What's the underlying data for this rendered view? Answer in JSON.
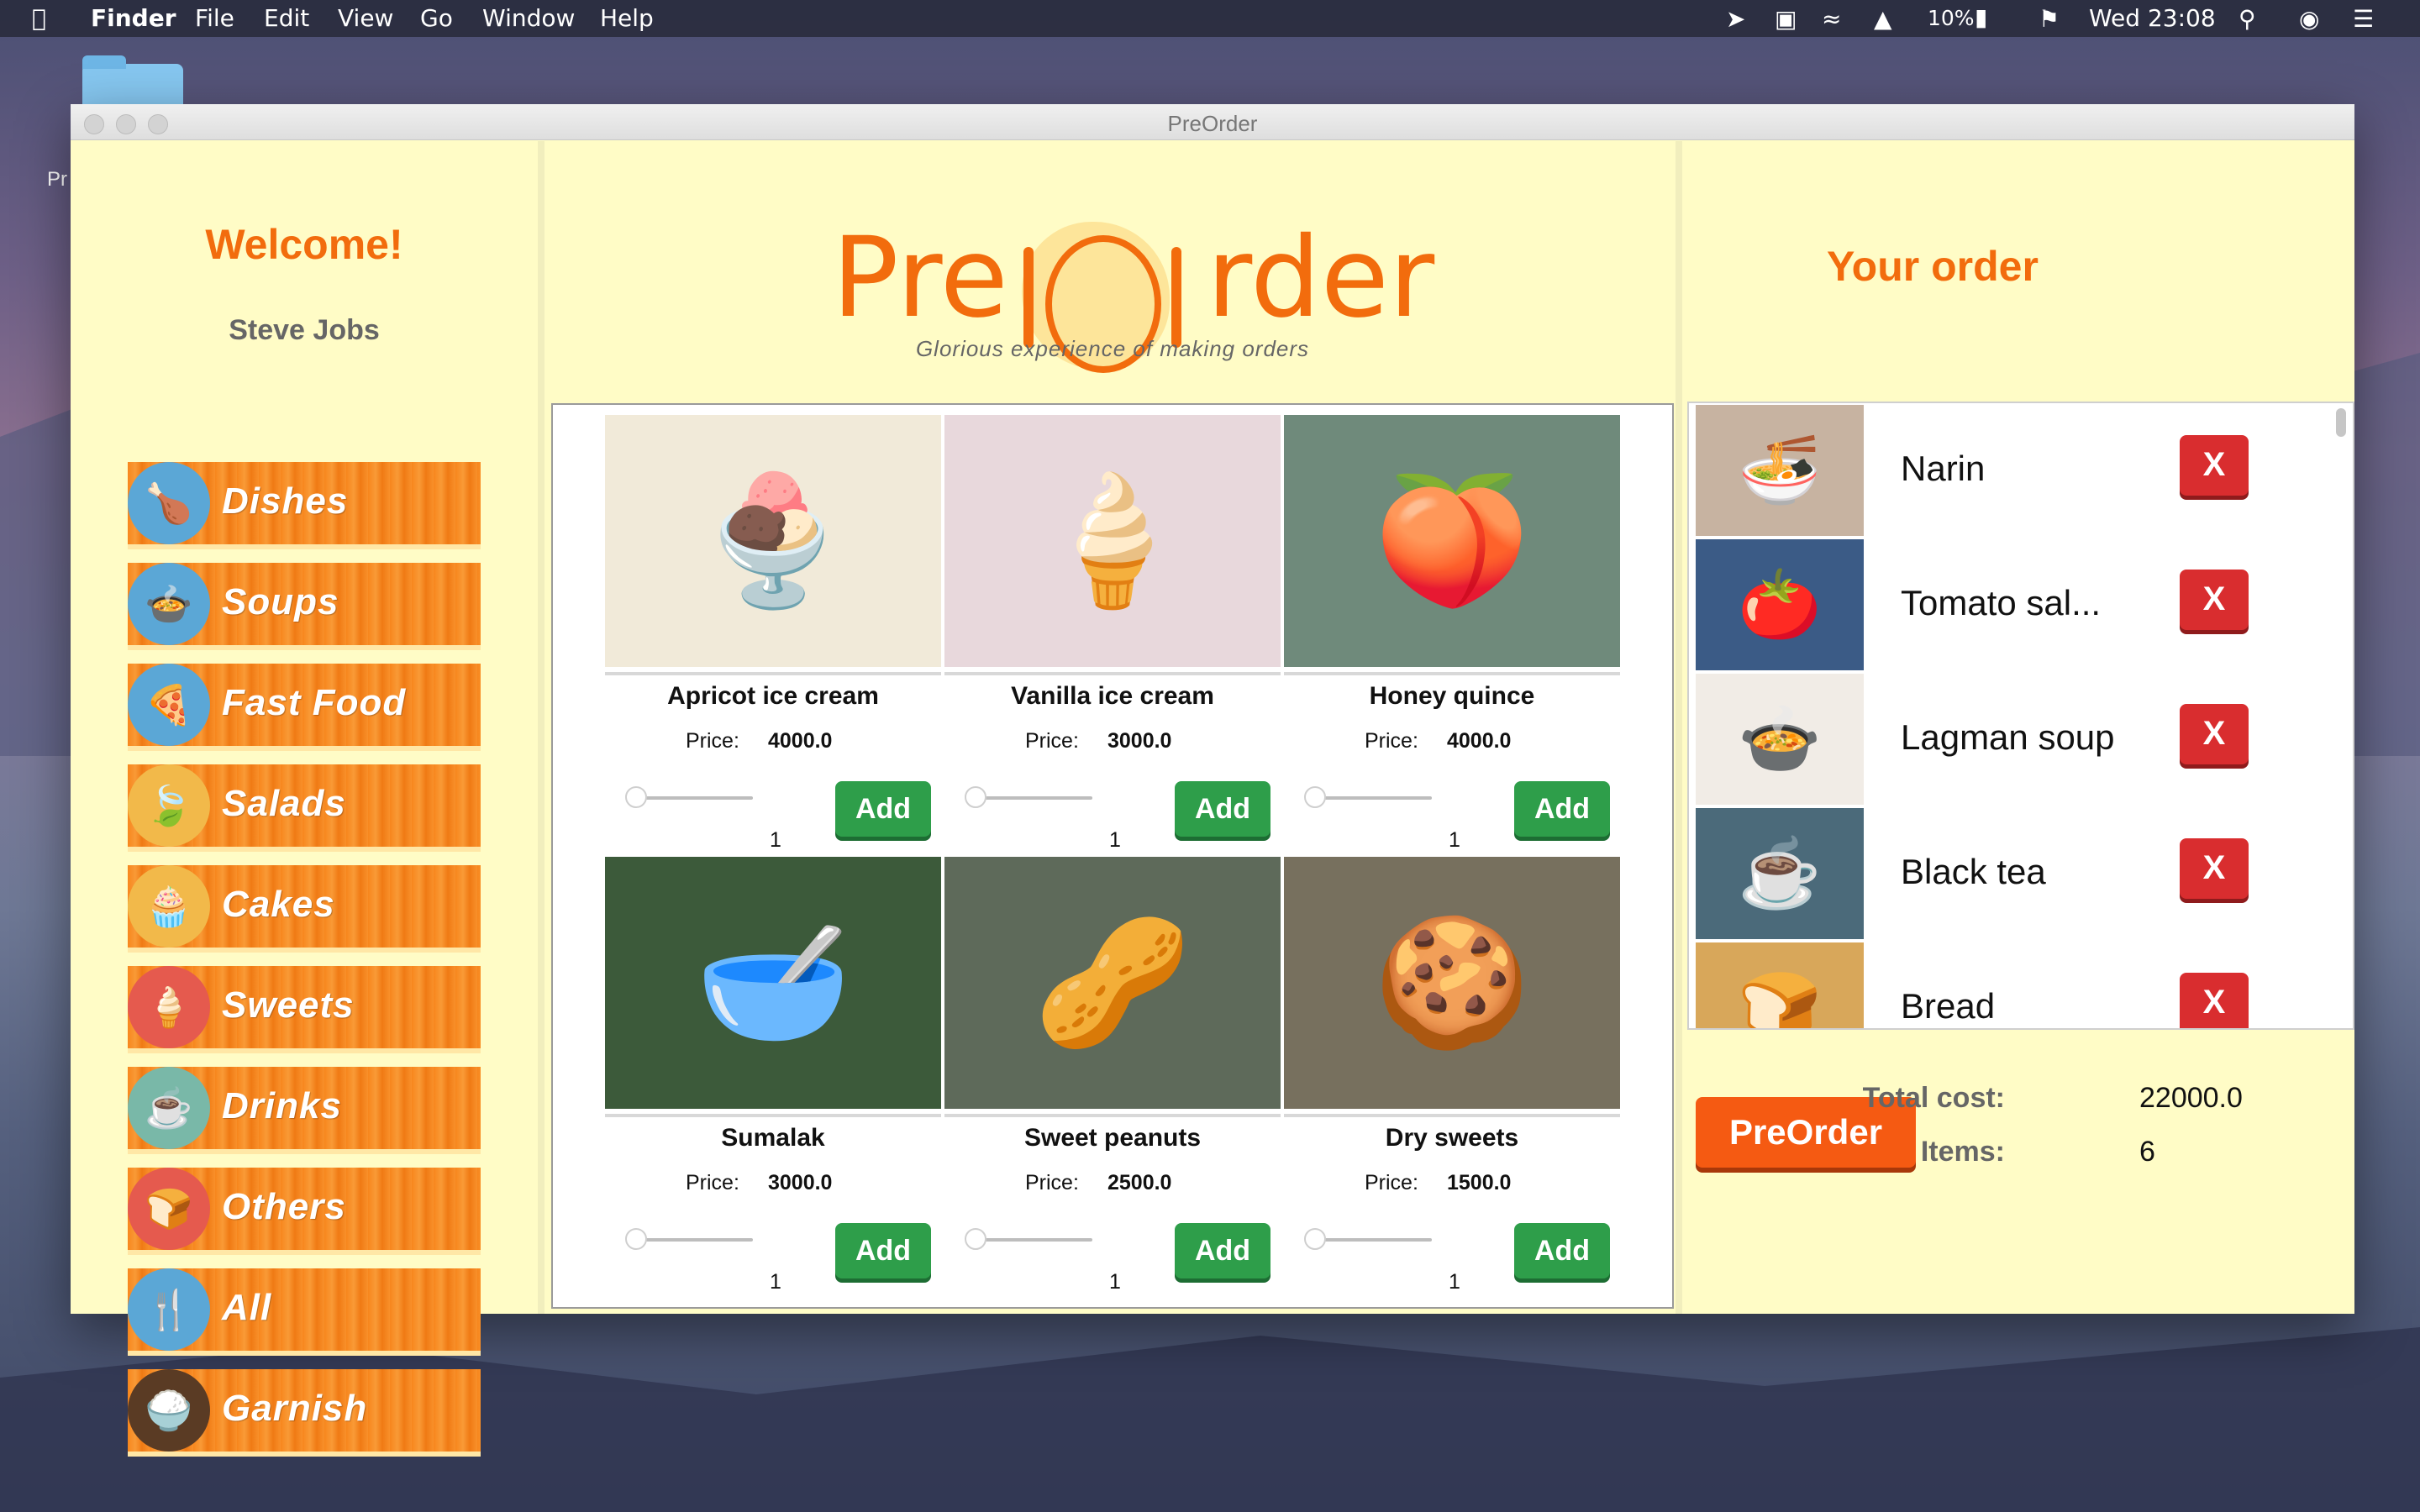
{
  "menubar": {
    "app": "Finder",
    "menus": [
      "File",
      "Edit",
      "View",
      "Go",
      "Window",
      "Help"
    ],
    "battery": "10%",
    "clock": "Wed 23:08"
  },
  "desktop": {
    "folder_label": "Pr"
  },
  "window": {
    "title": "PreOrder"
  },
  "left": {
    "welcome": "Welcome!",
    "user": "Steve Jobs",
    "categories": [
      {
        "label": "Dishes",
        "icon": "roast-chicken-icon",
        "color": "#5ba7d6"
      },
      {
        "label": "Soups",
        "icon": "soup-bowl-icon",
        "color": "#5ba7d6"
      },
      {
        "label": "Fast Food",
        "icon": "pizza-slice-icon",
        "color": "#5ba7d6"
      },
      {
        "label": "Salads",
        "icon": "leaf-icon",
        "color": "#f2b94a"
      },
      {
        "label": "Cakes",
        "icon": "cupcake-icon",
        "color": "#f2b94a"
      },
      {
        "label": "Sweets",
        "icon": "ice-cream-cone-icon",
        "color": "#e55a4e"
      },
      {
        "label": "Drinks",
        "icon": "tea-cup-icon",
        "color": "#79b8a8"
      },
      {
        "label": "Others",
        "icon": "bread-icon",
        "color": "#e55a4e"
      },
      {
        "label": "All",
        "icon": "fork-knife-icon",
        "color": "#5ba7d6"
      },
      {
        "label": "Garnish",
        "icon": "rice-bowl-icon",
        "color": "#5a3b24"
      }
    ]
  },
  "header": {
    "logo_left": "Pre",
    "logo_right": "rder",
    "tagline": "Glorious experience of making orders"
  },
  "products": [
    {
      "name": "Apricot ice cream",
      "price_label": "Price:",
      "price": "4000.0",
      "qty": "1",
      "add": "Add",
      "icon": "ice-cream-icon",
      "bg": "#f1ead9"
    },
    {
      "name": "Vanilla ice cream",
      "price_label": "Price:",
      "price": "3000.0",
      "qty": "1",
      "add": "Add",
      "icon": "ice-cream-cone-icon",
      "bg": "#e8d8dc"
    },
    {
      "name": "Honey quince",
      "price_label": "Price:",
      "price": "4000.0",
      "qty": "1",
      "add": "Add",
      "icon": "quince-plate-icon",
      "bg": "#6f8a7b"
    },
    {
      "name": "Sumalak",
      "price_label": "Price:",
      "price": "3000.0",
      "qty": "1",
      "add": "Add",
      "icon": "sumalak-bowl-icon",
      "bg": "#3c5a3a"
    },
    {
      "name": "Sweet peanuts",
      "price_label": "Price:",
      "price": "2500.0",
      "qty": "1",
      "add": "Add",
      "icon": "peanuts-icon",
      "bg": "#5e6a5a"
    },
    {
      "name": "Dry sweets",
      "price_label": "Price:",
      "price": "1500.0",
      "qty": "1",
      "add": "Add",
      "icon": "dry-sweets-icon",
      "bg": "#77705e"
    }
  ],
  "order": {
    "title": "Your order",
    "items": [
      {
        "name": "Narin",
        "icon": "noodles-icon",
        "bg": "#c7b3a1"
      },
      {
        "name": "Tomato sal...",
        "icon": "tomato-salad-icon",
        "bg": "#3b5b86"
      },
      {
        "name": "Lagman soup",
        "icon": "soup-bowl-icon",
        "bg": "#f1ece6"
      },
      {
        "name": "Black tea",
        "icon": "tea-cup-icon",
        "bg": "#4b6a7a"
      },
      {
        "name": "Bread",
        "icon": "bread-icon",
        "bg": "#d8a75a"
      }
    ],
    "remove_label": "X",
    "preorder_button": "PreOrder",
    "total_label": "Total cost:",
    "total_value": "22000.0",
    "items_label": "Items:",
    "items_value": "6"
  }
}
